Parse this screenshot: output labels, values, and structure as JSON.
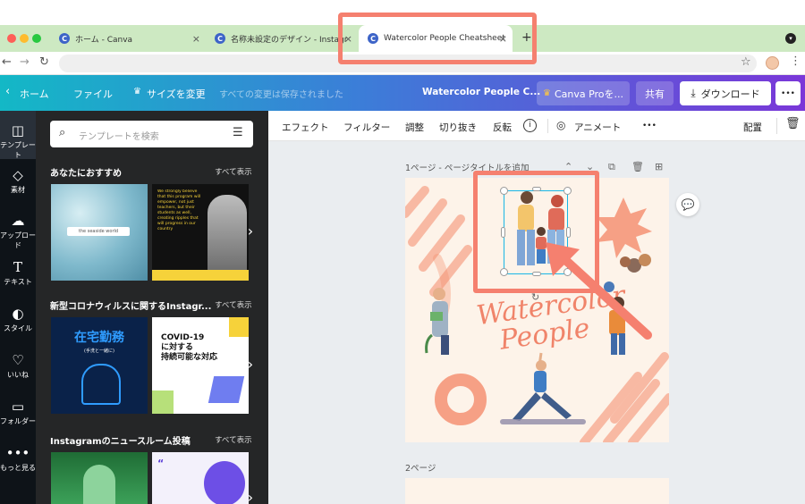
{
  "browser": {
    "tabs": [
      {
        "title": "ホーム - Canva",
        "favicon": "C"
      },
      {
        "title": "名称未設定のデザイン - Instagram",
        "favicon": "C"
      },
      {
        "title": "Watercolor People Cheatsheet",
        "favicon": "C",
        "active": true
      }
    ],
    "new_tab_label": "+",
    "close_label": "×"
  },
  "canva_topbar": {
    "home_label": "ホーム",
    "file_label": "ファイル",
    "resize_label": "サイズを変更",
    "save_status": "すべての変更は保存されました",
    "design_title": "Watercolor People C...",
    "pro_label": "Canva Proを...",
    "share_label": "共有",
    "download_label": "ダウンロード",
    "more_label": "•••"
  },
  "rail": {
    "items": [
      {
        "label": "テンプレート",
        "icon": "template-icon"
      },
      {
        "label": "素材",
        "icon": "elements-icon"
      },
      {
        "label": "アップロード",
        "icon": "upload-icon"
      },
      {
        "label": "テキスト",
        "icon": "text-icon"
      },
      {
        "label": "スタイル",
        "icon": "palette-icon"
      },
      {
        "label": "いいね",
        "icon": "heart-icon"
      },
      {
        "label": "フォルダー",
        "icon": "folder-icon"
      },
      {
        "label": "もっと見る",
        "icon": "more-icon"
      }
    ]
  },
  "panel": {
    "search_placeholder": "テンプレートを検索",
    "sections": [
      {
        "heading": "あなたにおすすめ",
        "see_all": "すべて表示",
        "thumb1_text": "the seaside world",
        "thumb2_text": "We strongly believe that this program will empower, not just teachers, but their students as well, creating ripples that will progress in our country"
      },
      {
        "heading": "新型コロナウィルスに関するInstagr...",
        "see_all": "すべて表示",
        "thumb1_title": "在宅勤務",
        "thumb1_sub": "(手洗と一緒に)",
        "thumb2_title": "COVID-19\nに対する\n持続可能な対応"
      },
      {
        "heading": "Instagramのニュースルーム投稿",
        "see_all": "すべて表示"
      }
    ]
  },
  "toolbar": {
    "effects": "エフェクト",
    "filter": "フィルター",
    "adjust": "調整",
    "crop": "切り抜き",
    "flip": "反転",
    "animate": "アニメート",
    "more": "•••",
    "position": "配置"
  },
  "pages": {
    "page1_label": "1ページ - ページタイトルを追加",
    "page2_label": "2ページ",
    "design_text_line1": "Watercolor",
    "design_text_line2": "People"
  },
  "colors": {
    "annotation": "#f5806f",
    "brand_gradient_start": "#13b8c6",
    "brand_gradient_end": "#7a37d8",
    "selection": "#19b6e6"
  }
}
